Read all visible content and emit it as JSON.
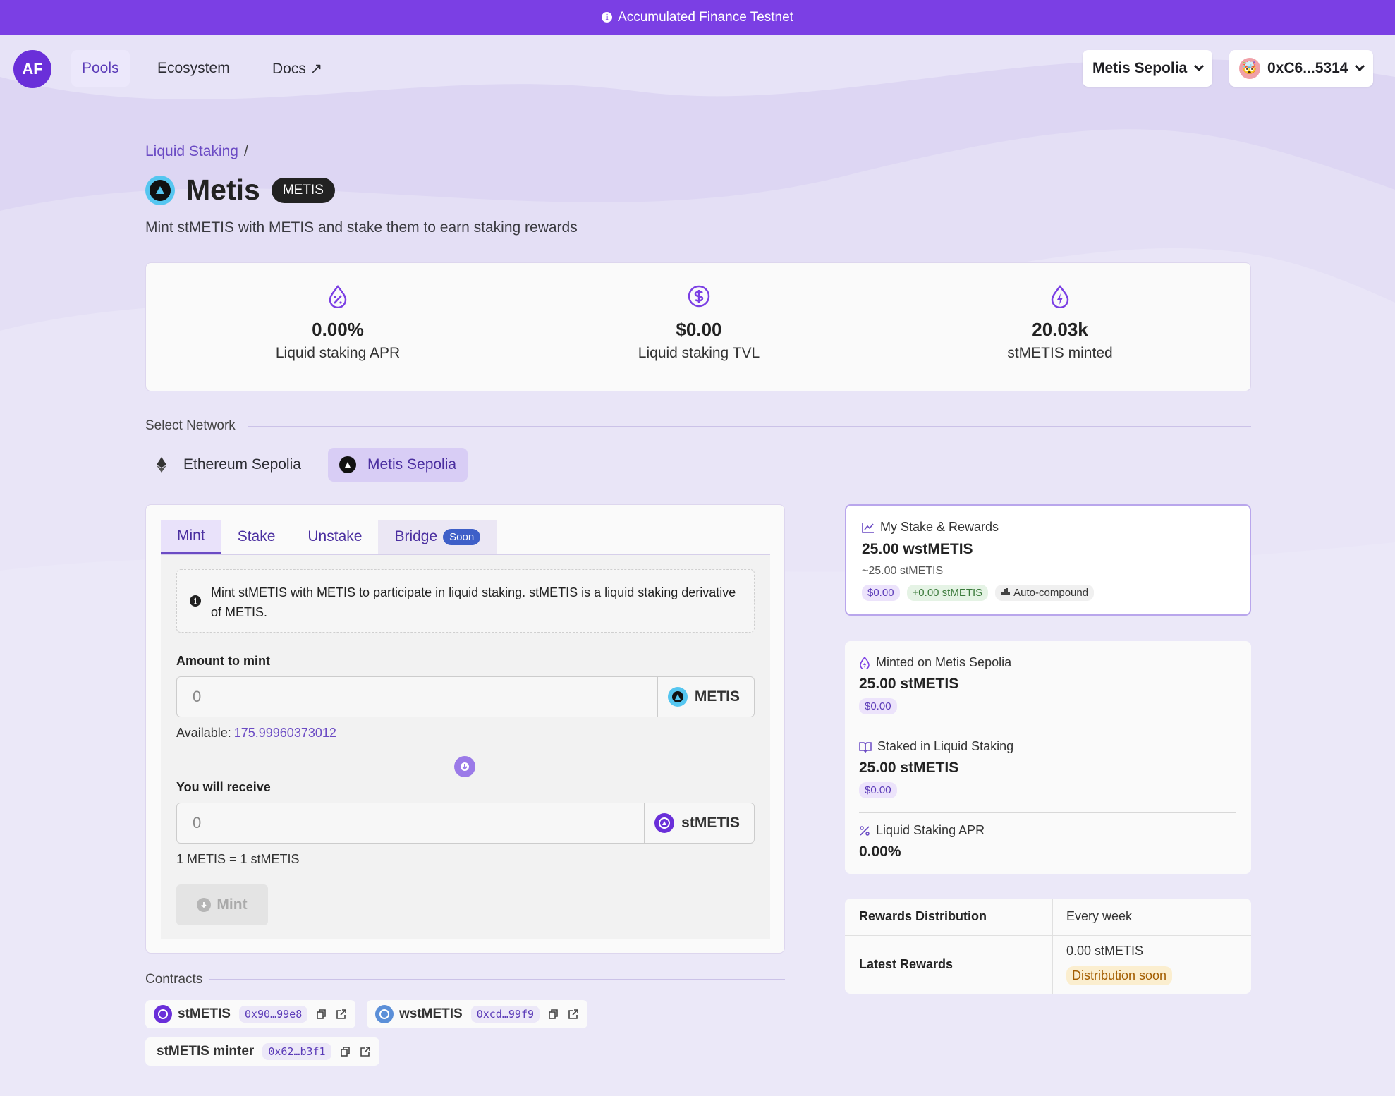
{
  "banner": {
    "text": "Accumulated Finance Testnet"
  },
  "nav": {
    "logo": "AF",
    "links": [
      "Pools",
      "Ecosystem",
      "Docs ↗"
    ],
    "network_button": "Metis Sepolia",
    "wallet_button": "0xC6...5314",
    "wallet_emoji": "🤯"
  },
  "breadcrumb": {
    "parent": "Liquid Staking",
    "sep": "/"
  },
  "page": {
    "title": "Metis",
    "ticker": "METIS",
    "subtitle": "Mint stMETIS with METIS and stake them to earn staking rewards"
  },
  "stats": [
    {
      "value": "0.00%",
      "label": "Liquid staking APR",
      "icon": "percent-drop-icon"
    },
    {
      "value": "$0.00",
      "label": "Liquid staking TVL",
      "icon": "dollar-circle-icon"
    },
    {
      "value": "20.03k",
      "label": "stMETIS minted",
      "icon": "bolt-drop-icon"
    }
  ],
  "network_select": {
    "label": "Select Network",
    "options": [
      "Ethereum Sepolia",
      "Metis Sepolia"
    ],
    "selected": "Metis Sepolia"
  },
  "mint_panel": {
    "tabs": [
      "Mint",
      "Stake",
      "Unstake",
      "Bridge"
    ],
    "soon_badge": "Soon",
    "info": "Mint stMETIS with METIS to participate in liquid staking. stMETIS is a liquid staking derivative of METIS.",
    "amount_label": "Amount to mint",
    "amount_placeholder": "0",
    "amount_token": "METIS",
    "available_label": "Available:",
    "available_amount": "175.99960373012",
    "receive_label": "You will receive",
    "receive_placeholder": "0",
    "receive_token": "stMETIS",
    "rate": "1 METIS = 1 stMETIS",
    "mint_button": "Mint"
  },
  "contracts": {
    "label": "Contracts",
    "items": [
      {
        "name": "stMETIS",
        "address": "0x90…99e8"
      },
      {
        "name": "wstMETIS",
        "address": "0xcd…99f9"
      },
      {
        "name": "stMETIS minter",
        "address": "0x62…b3f1"
      }
    ]
  },
  "my_stake": {
    "title": "My Stake & Rewards",
    "amount": "25.00 wstMETIS",
    "approx": "~25.00 stMETIS",
    "usd": "$0.00",
    "rewards": "+0.00 stMETIS",
    "auto": "Auto-compound"
  },
  "details": {
    "minted_label": "Minted on Metis Sepolia",
    "minted_value": "25.00 stMETIS",
    "minted_usd": "$0.00",
    "staked_label": "Staked in Liquid Staking",
    "staked_value": "25.00 stMETIS",
    "staked_usd": "$0.00",
    "apr_label": "Liquid Staking APR",
    "apr_value": "0.00%"
  },
  "rewards_table": {
    "dist_label": "Rewards Distribution",
    "dist_value": "Every week",
    "latest_label": "Latest Rewards",
    "latest_value": "0.00 stMETIS",
    "latest_badge": "Distribution soon"
  },
  "colors": {
    "accent": "#7b3fe4",
    "link": "#6b4bc4",
    "background": "#e7e3f7"
  }
}
